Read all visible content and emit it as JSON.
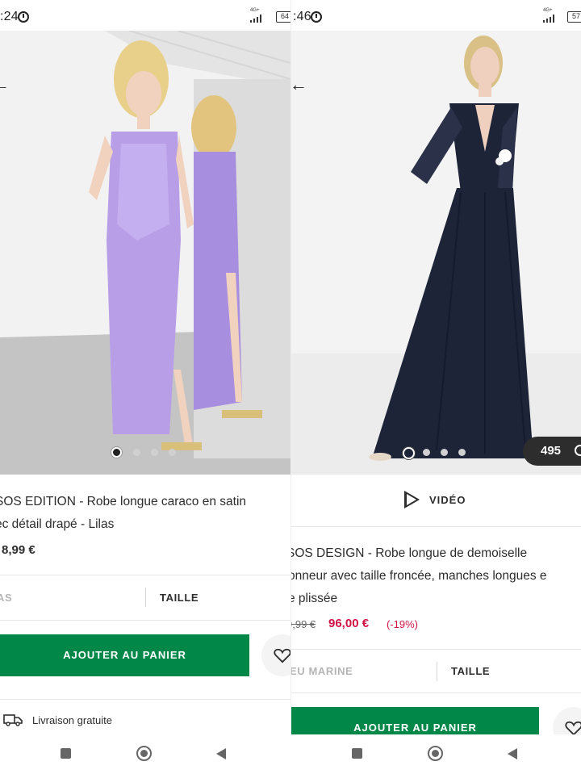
{
  "left": {
    "status": {
      "time": ":24",
      "network": "4G+",
      "battery": "64"
    },
    "back_glyph": "←",
    "gallery": {
      "dots": 4,
      "active": 0
    },
    "product": {
      "title_line1": "SOS EDITION - Robe longue caraco en satin",
      "title_line2": "ec détail drapé - Lilas",
      "price": "8,99 €"
    },
    "color_label": "AS",
    "size_label": "TAILLE",
    "add_to_cart": "AJOUTER AU PANIER",
    "delivery": "Livraison gratuite"
  },
  "right": {
    "status": {
      "time": ":46",
      "network": "4G+",
      "battery": "57"
    },
    "back_glyph": "←",
    "gallery": {
      "dots": 4,
      "active": 0
    },
    "saves": "495",
    "video_label": "VIDÉO",
    "product": {
      "title_line1": "SOS DESIGN - Robe longue de demoiselle",
      "title_line2": "onneur avec taille froncée, manches longues e",
      "title_line3": "e plissée",
      "old_price": "9,99 €",
      "price": "96,00 €",
      "discount": "(-19%)"
    },
    "color_label": "EU MARINE",
    "size_label": "TAILLE",
    "add_to_cart": "AJOUTER AU PANIER"
  },
  "colors": {
    "accent_green": "#018849",
    "sale_red": "#d01345",
    "lilac": "#b79ee6",
    "navy": "#1d2438"
  },
  "icons": [
    "alarm-icon",
    "signal-icon",
    "battery-icon",
    "back-arrow-icon",
    "play-icon",
    "heart-icon",
    "truck-icon",
    "nav-recents-icon",
    "nav-home-icon",
    "nav-back-icon"
  ]
}
